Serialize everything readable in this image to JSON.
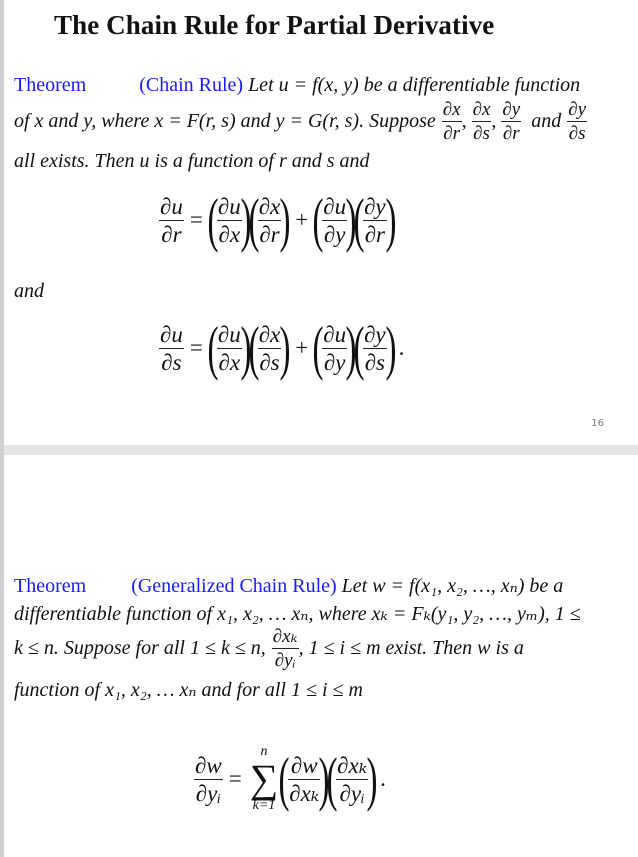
{
  "page1": {
    "title": "The Chain Rule for Partial Derivative",
    "theorem": {
      "label": "Theorem",
      "name": "(Chain Rule)",
      "line1_text": "Let u = f(x, y) be a differentiable function",
      "line2_prefix": "of x and y, where x = F(r, s) and y = G(r, s). Suppose",
      "line2_fracs": [
        {
          "num": "∂x",
          "den": "∂r",
          "sep": ","
        },
        {
          "num": "∂x",
          "den": "∂s",
          "sep": ","
        },
        {
          "num": "∂y",
          "den": "∂r",
          "sep": ""
        }
      ],
      "line2_and": "and",
      "line2_last_frac": {
        "num": "∂y",
        "den": "∂s"
      },
      "line3_text": "all exists. Then u is a function of r and s and"
    },
    "equation1": {
      "lhs": {
        "num": "∂u",
        "den": "∂r"
      },
      "eq": "=",
      "plus": "+",
      "terms": [
        [
          {
            "num": "∂u",
            "den": "∂x"
          },
          {
            "num": "∂x",
            "den": "∂r"
          }
        ],
        [
          {
            "num": "∂u",
            "den": "∂y"
          },
          {
            "num": "∂y",
            "den": "∂r"
          }
        ]
      ],
      "end": ""
    },
    "and_text": "and",
    "equation2": {
      "lhs": {
        "num": "∂u",
        "den": "∂s"
      },
      "eq": "=",
      "plus": "+",
      "terms": [
        [
          {
            "num": "∂u",
            "den": "∂x"
          },
          {
            "num": "∂x",
            "den": "∂s"
          }
        ],
        [
          {
            "num": "∂u",
            "den": "∂y"
          },
          {
            "num": "∂y",
            "den": "∂s"
          }
        ]
      ],
      "end": "."
    },
    "page_number": "16"
  },
  "page2": {
    "theorem": {
      "label": "Theorem",
      "name": "(Generalized Chain Rule)",
      "line1_text": "Let w = f(x₁, x₂, …, xₙ) be a",
      "line2_text": "differentiable function of x₁, x₂, … xₙ, where xₖ = Fₖ(y₁, y₂, …, yₘ), 1 ≤",
      "line3_prefix": "k ≤ n.  Suppose for all 1 ≤ k ≤ n,",
      "line3_frac": {
        "num": "∂xₖ",
        "den": "∂yᵢ"
      },
      "line3_suffix": ", 1 ≤ i ≤ m exist.  Then w is a",
      "line4_text": "function of x₁, x₂, … xₙ and for all 1 ≤ i ≤ m"
    },
    "equation": {
      "lhs": {
        "num": "∂w",
        "den": "∂yᵢ"
      },
      "eq": "=",
      "sum_symbol": "∑",
      "sum_upper": "n",
      "sum_lower": "k=1",
      "factors": [
        {
          "num": "∂w",
          "den": "∂xₖ"
        },
        {
          "num": "∂xₖ",
          "den": "∂yᵢ"
        }
      ],
      "end": "."
    }
  },
  "colors": {
    "theorem_label": "#1a1aff",
    "page_gap": "#e4e4e4",
    "text": "#111111"
  }
}
